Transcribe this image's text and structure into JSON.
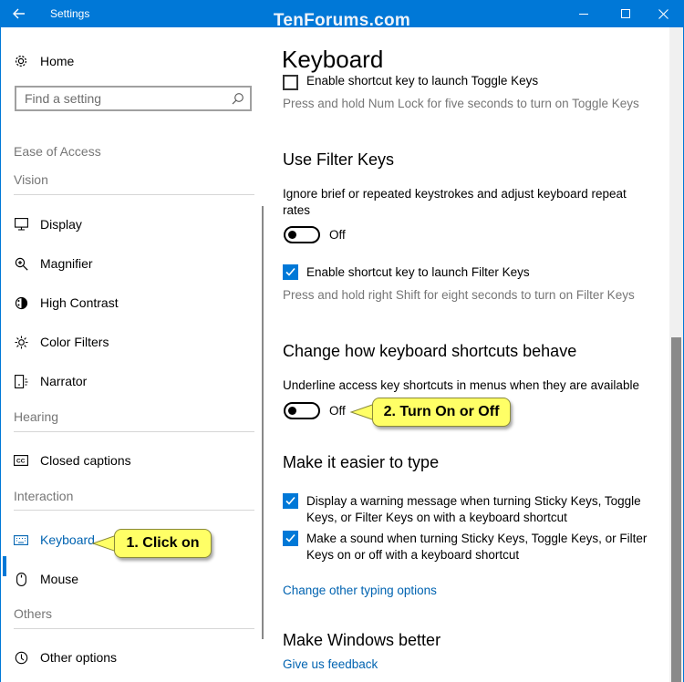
{
  "titlebar": {
    "title": "Settings",
    "watermark": "TenForums.com"
  },
  "sidebar": {
    "home_label": "Home",
    "search_placeholder": "Find a setting",
    "section_title": "Ease of Access",
    "categories": {
      "vision": "Vision",
      "hearing": "Hearing",
      "interaction": "Interaction",
      "others": "Others"
    },
    "items": [
      {
        "label": "Display",
        "icon": "display-icon"
      },
      {
        "label": "Magnifier",
        "icon": "magnifier-icon"
      },
      {
        "label": "High Contrast",
        "icon": "high-contrast-icon"
      },
      {
        "label": "Color Filters",
        "icon": "color-filters-icon"
      },
      {
        "label": "Narrator",
        "icon": "narrator-icon"
      },
      {
        "label": "Closed captions",
        "icon": "closed-captions-icon"
      },
      {
        "label": "Keyboard",
        "icon": "keyboard-icon",
        "active": true
      },
      {
        "label": "Mouse",
        "icon": "mouse-icon"
      },
      {
        "label": "Other options",
        "icon": "other-options-icon"
      }
    ]
  },
  "callouts": {
    "click_on": "1. Click on",
    "turn_on_off": "2. Turn On or Off"
  },
  "main": {
    "page_title": "Keyboard",
    "toggle_keys": {
      "checkbox_label": "Enable shortcut key to launch Toggle Keys",
      "checked": false,
      "hint": "Press and hold Num Lock for five seconds to turn on Toggle Keys"
    },
    "filter_keys": {
      "heading": "Use Filter Keys",
      "description": "Ignore brief or repeated keystrokes and adjust keyboard repeat rates",
      "toggle_state": "Off",
      "checkbox_label": "Enable shortcut key to launch Filter Keys",
      "checked": true,
      "hint": "Press and hold right Shift for eight seconds to turn on Filter Keys"
    },
    "shortcuts": {
      "heading": "Change how keyboard shortcuts behave",
      "description": "Underline access key shortcuts in menus when they are available",
      "toggle_state": "Off"
    },
    "easier_type": {
      "heading": "Make it easier to type",
      "checkbox1_label": "Display a warning message when turning Sticky Keys, Toggle Keys, or Filter Keys on with a keyboard shortcut",
      "checkbox1_checked": true,
      "checkbox2_label": "Make a sound when turning Sticky Keys, Toggle Keys, or Filter Keys on or off with a keyboard shortcut",
      "checkbox2_checked": true,
      "link": "Change other typing options"
    },
    "windows_better": {
      "heading": "Make Windows better",
      "link": "Give us feedback"
    }
  },
  "colors": {
    "accent": "#0078d7",
    "link": "#0063b1",
    "callout": "#ffff66"
  }
}
